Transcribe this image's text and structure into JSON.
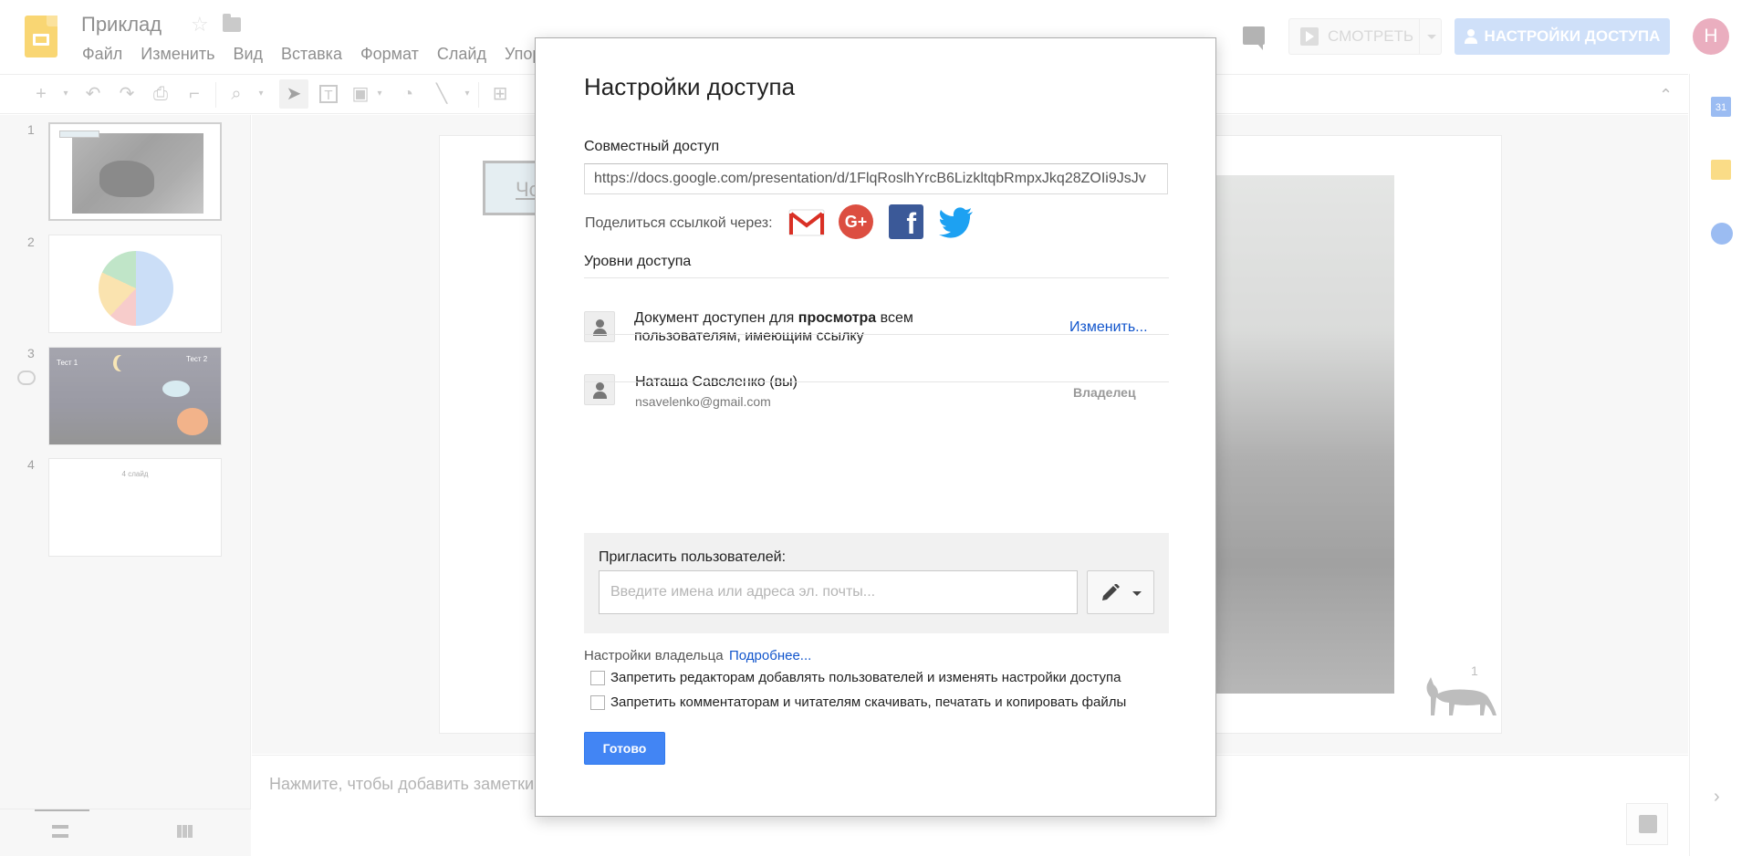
{
  "header": {
    "title": "Приклад",
    "menu": [
      "Файл",
      "Изменить",
      "Вид",
      "Вставка",
      "Формат",
      "Слайд",
      "Упор"
    ],
    "present_label": "СМОТРЕТЬ",
    "share_label": "НАСТРОЙКИ ДОСТУПА",
    "avatar_letter": "Н"
  },
  "sidebar": {
    "slides": [
      {
        "number": "1"
      },
      {
        "number": "2"
      },
      {
        "number": "3",
        "texts": [
          "Тест 1",
          "Тест 2"
        ]
      },
      {
        "number": "4",
        "title": "4 слайд"
      }
    ]
  },
  "canvas": {
    "slide_tag": "Чо",
    "slide_number": "1",
    "notes_placeholder": "Нажмите, чтобы добавить заметки"
  },
  "side_panel": {
    "calendar_day": "31"
  },
  "dialog": {
    "title": "Настройки доступа",
    "shared_label": "Совместный доступ",
    "link": "https://docs.google.com/presentation/d/1FlqRoslhYrcB6LizkltqbRmpxJkq28ZOIi9JsJv",
    "share_via_label": "Поделиться ссылкой через:",
    "levels_label": "Уровни доступа",
    "access": {
      "prefix": "Документ доступен для ",
      "bold": "просмотра",
      "suffix": " всем пользователям, имеющим ссылку",
      "change_label": "Изменить..."
    },
    "owner": {
      "name": "Наташа Савеленко (вы)",
      "email": "nsavelenko@gmail.com",
      "role": "Владелец"
    },
    "invite": {
      "label": "Пригласить пользователей:",
      "placeholder": "Введите имена или адреса эл. почты..."
    },
    "owner_settings": {
      "label": "Настройки владельца",
      "more_label": "Подробнее...",
      "checkbox1": "Запретить редакторам добавлять пользователей и изменять настройки доступа",
      "checkbox2": "Запретить комментаторам и читателям скачивать, печатать и копировать файлы"
    },
    "done_label": "Готово"
  },
  "colors": {
    "accent_blue": "#4285f4",
    "share_button_faded": "#a8c7f4",
    "link_blue": "#1155cc",
    "slides_yellow": "#f4b400",
    "avatar_pink": "#d96c8a"
  }
}
